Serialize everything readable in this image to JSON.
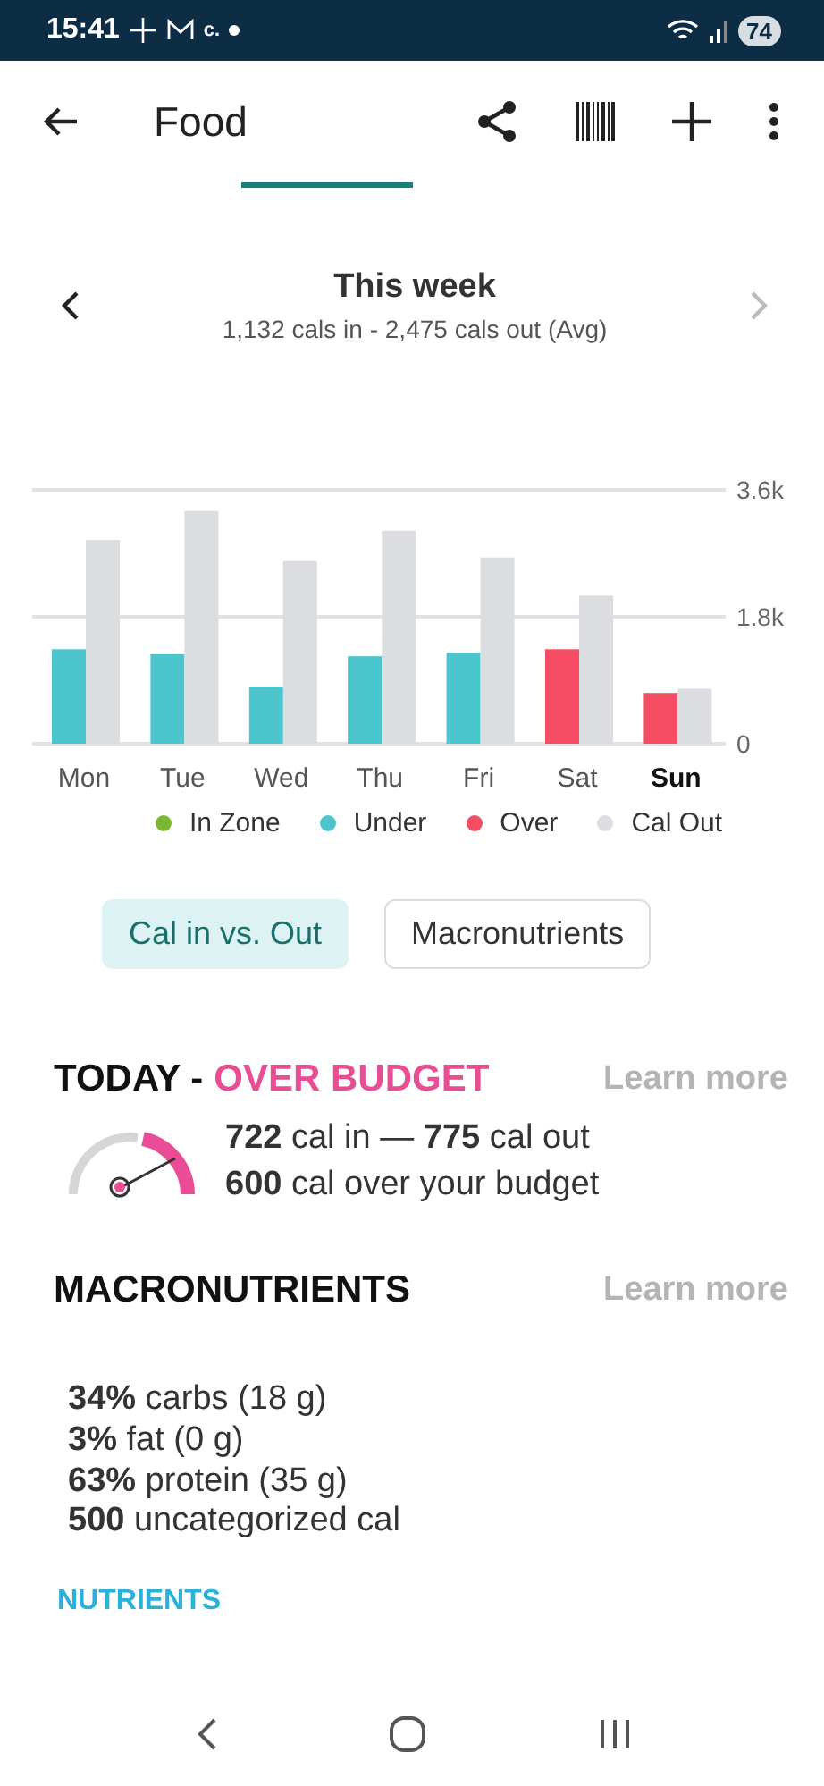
{
  "status_bar": {
    "time": "15:41",
    "carrier_text": "c.",
    "battery": "74"
  },
  "header": {
    "title": "Food"
  },
  "week": {
    "title": "This week",
    "subtitle": "1,132 cals in - 2,475 cals out (Avg)"
  },
  "chart": {
    "days": [
      {
        "selected": false
      },
      {
        "selected": false
      },
      {
        "selected": false
      },
      {
        "selected": false
      },
      {
        "selected": false
      },
      {
        "selected": false
      },
      {
        "selected": true
      }
    ],
    "chart_data": {
      "type": "bar",
      "categories": [
        "Mon",
        "Tue",
        "Wed",
        "Thu",
        "Fri",
        "Sat",
        "Sun"
      ],
      "legend": "bottom",
      "ylim": [
        0,
        3600
      ],
      "yticks": [
        {
          "value": 0,
          "label": "0"
        },
        {
          "value": 1800,
          "label": "1.8k"
        },
        {
          "value": 3600,
          "label": "3.6k"
        }
      ],
      "series": [
        {
          "name": "In Zone",
          "color": "#7cb82f",
          "values": [
            null,
            null,
            null,
            null,
            null,
            null,
            null
          ]
        },
        {
          "name": "Under",
          "color": "#4cc6cc",
          "values": [
            1340,
            1270,
            810,
            1240,
            1290,
            null,
            null
          ]
        },
        {
          "name": "Over",
          "color": "#f44d64",
          "values": [
            null,
            null,
            null,
            null,
            null,
            1340,
            720
          ]
        },
        {
          "name": "Cal Out",
          "color": "#dcdde0",
          "values": [
            2890,
            3300,
            2590,
            3020,
            2640,
            2100,
            780
          ]
        }
      ]
    }
  },
  "view_toggle": [
    {
      "label": "Cal in vs. Out",
      "selected": true
    },
    {
      "label": "Macronutrients",
      "selected": false
    }
  ],
  "today": {
    "title": "TODAY -",
    "status": "OVER BUDGET",
    "link": "Learn more",
    "lines": [
      "**722** cal in — **775** cal out",
      "**600** cal over your budget"
    ]
  },
  "macronutrients": {
    "title": "MACRONUTRIENTS",
    "link": "Learn more",
    "lines": [
      "**34%** carbs (18 g)",
      "**3%** fat (0 g)",
      "**63%** protein (35 g)",
      "**500** uncategorized cal"
    ]
  },
  "nutrients_link": "NUTRIENTS"
}
